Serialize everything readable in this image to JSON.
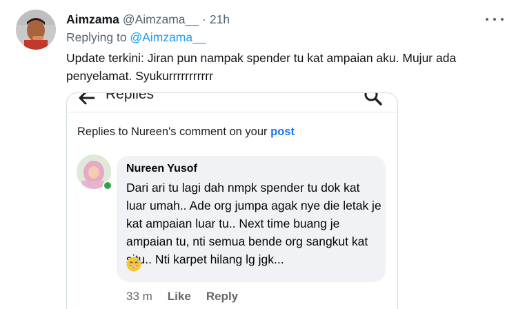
{
  "tweet": {
    "author_name": "Aimzama",
    "author_handle": "@Aimzama__",
    "separator": "·",
    "time": "21h",
    "replying_prefix": "Replying to ",
    "replying_to": "@Aimzama__",
    "text": "Update terkini: Jiran pun nampak spender tu kat ampaian aku. Mujur ada penyelamat. Syukurrrrrrrrrrr"
  },
  "embedded": {
    "title": "Replies",
    "replies_prefix": "Replies to Nureen's comment on your ",
    "replies_link": "post",
    "comment": {
      "name": "Nureen Yusof",
      "text": "Dari ari tu lagi dah nmpk spender tu dok kat luar umah.. Ade org jumpa agak nye die letak je kat ampaian luar tu.. Next time buang je ampaian tu, nti semua bende org sangkut kat situ.. Nti karpet hilang lg jgk...",
      "emoji": "grinning-sweat-emoji",
      "time_ago": "33 m",
      "like_label": "Like",
      "reply_label": "Reply"
    }
  },
  "colors": {
    "link": "#1d9bf0",
    "facebook_link": "#1877f2",
    "online": "#31a24c",
    "bubble": "#f0f2f5"
  },
  "icons": [
    "more-icon",
    "back-arrow-icon",
    "search-icon"
  ]
}
